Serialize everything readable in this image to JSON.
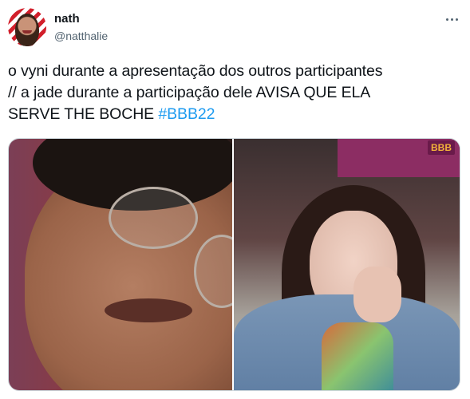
{
  "tweet": {
    "author_name": "nath",
    "author_handle": "@natthalie",
    "text_lines": [
      "o vyni durante a apresentação dos outros participantes",
      "// a jade durante a participação dele AVISA QUE ELA",
      "SERVE THE BOCHE "
    ],
    "hashtag": "#BBB22",
    "media": {
      "right_photo_logo": "BBB"
    }
  },
  "colors": {
    "text": "#0f1419",
    "secondary_text": "#536471",
    "link": "#1d9bf0",
    "border": "#cfd9de"
  },
  "icons": {
    "more": "more-horizontal-icon"
  }
}
